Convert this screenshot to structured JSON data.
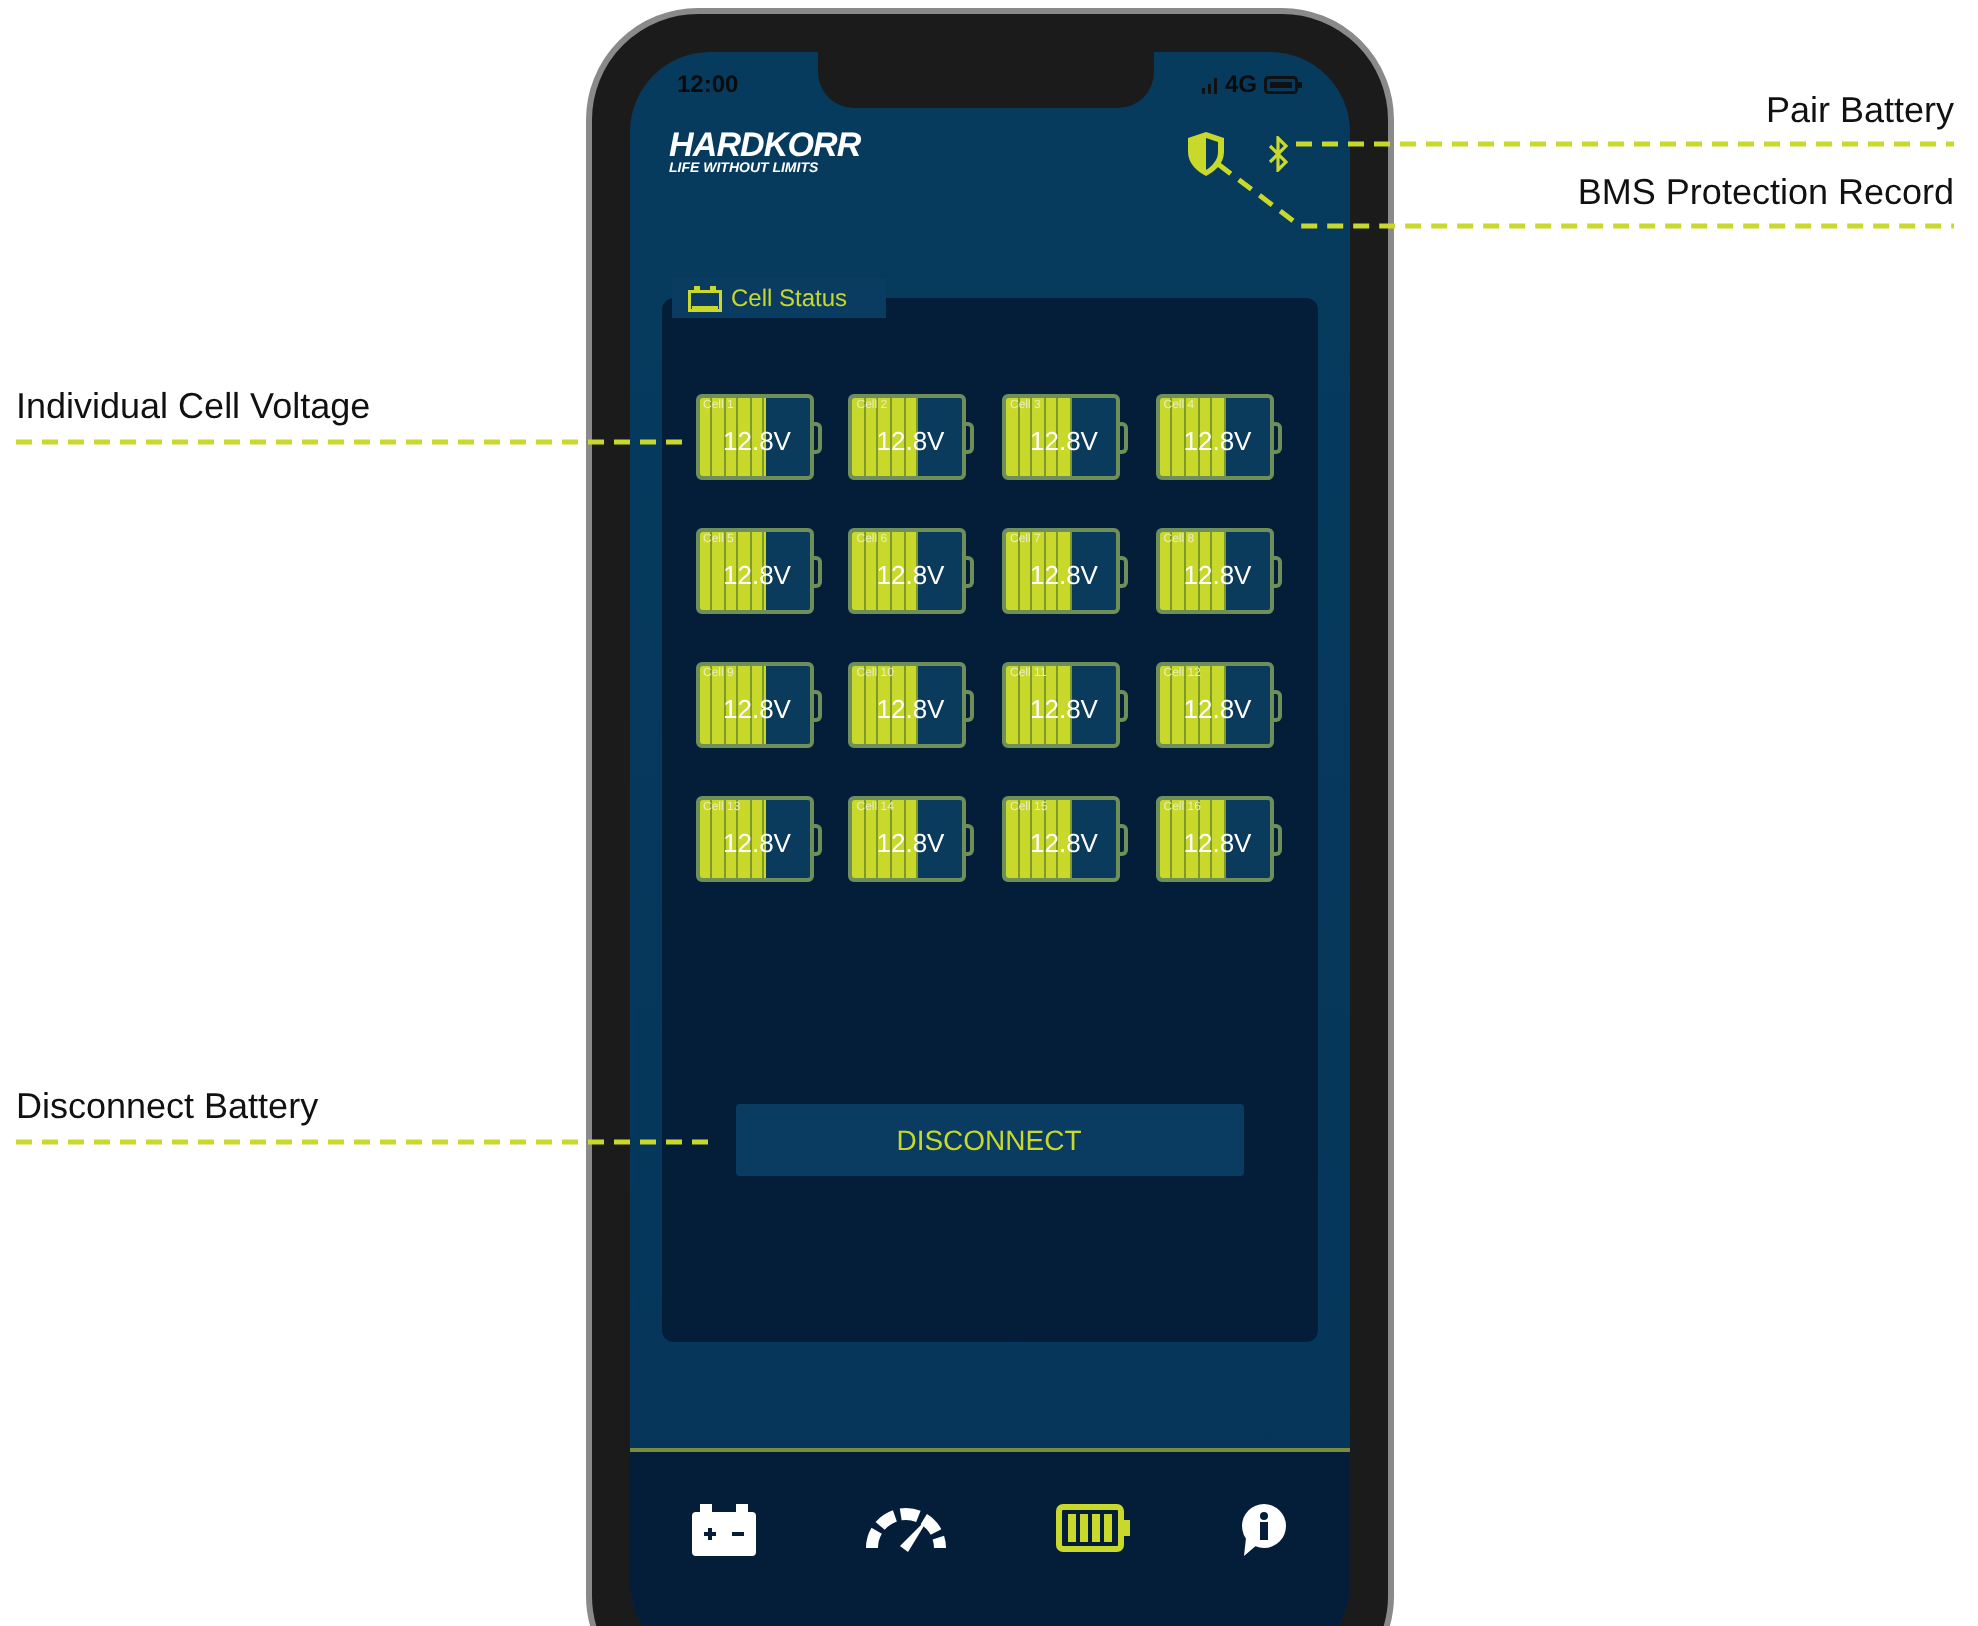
{
  "status_bar": {
    "time": "12:00",
    "network": "4G"
  },
  "logo": {
    "name": "HARDKORR",
    "tagline": "LIFE WITHOUT LIMITS"
  },
  "panel": {
    "title": "Cell Status"
  },
  "cells": [
    {
      "label": "Cell 1",
      "voltage": "12.8V"
    },
    {
      "label": "Cell 2",
      "voltage": "12.8V"
    },
    {
      "label": "Cell 3",
      "voltage": "12.8V"
    },
    {
      "label": "Cell 4",
      "voltage": "12.8V"
    },
    {
      "label": "Cell 5",
      "voltage": "12.8V"
    },
    {
      "label": "Cell 6",
      "voltage": "12.8V"
    },
    {
      "label": "Cell 7",
      "voltage": "12.8V"
    },
    {
      "label": "Cell 8",
      "voltage": "12.8V"
    },
    {
      "label": "Cell 9",
      "voltage": "12.8V"
    },
    {
      "label": "Cell 10",
      "voltage": "12.8V"
    },
    {
      "label": "Cell 11",
      "voltage": "12.8V"
    },
    {
      "label": "Cell 12",
      "voltage": "12.8V"
    },
    {
      "label": "Cell 13",
      "voltage": "12.8V"
    },
    {
      "label": "Cell 14",
      "voltage": "12.8V"
    },
    {
      "label": "Cell 15",
      "voltage": "12.8V"
    },
    {
      "label": "Cell 16",
      "voltage": "12.8V"
    }
  ],
  "disconnect_button": "DISCONNECT",
  "nav": [
    {
      "kind": "battery",
      "selected": false
    },
    {
      "kind": "gauge",
      "selected": false
    },
    {
      "kind": "cells",
      "selected": true
    },
    {
      "kind": "info",
      "selected": false
    }
  ],
  "callouts": {
    "pair_battery": "Pair Battery",
    "bms_record": "BMS Protection Record",
    "cell_voltage": "Individual Cell Voltage",
    "disconnect": "Disconnect Battery"
  }
}
